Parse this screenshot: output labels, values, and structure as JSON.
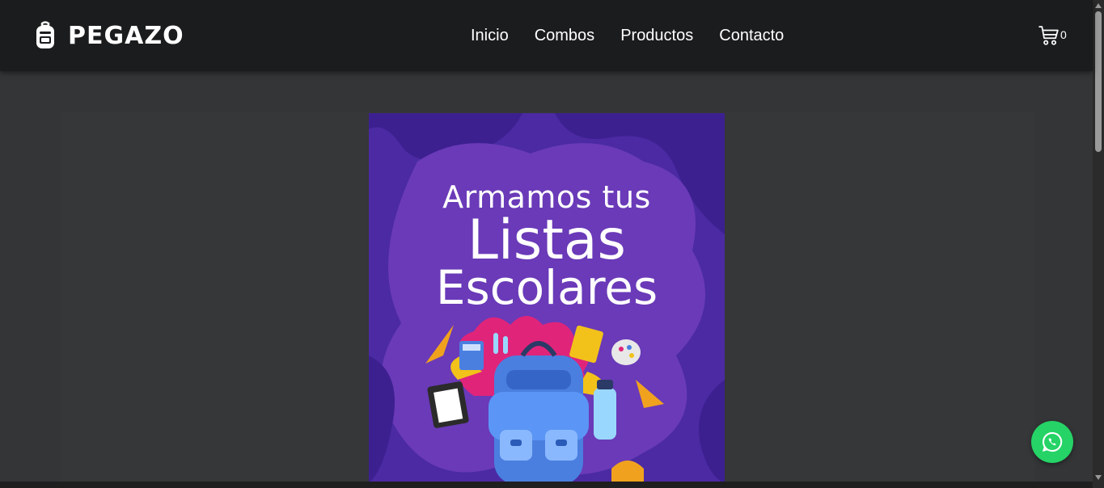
{
  "brand": {
    "name": "PEGAZO",
    "logo_icon": "backpack-icon"
  },
  "nav": {
    "links": [
      {
        "label": "Inicio"
      },
      {
        "label": "Combos"
      },
      {
        "label": "Productos"
      },
      {
        "label": "Contacto"
      }
    ]
  },
  "cart": {
    "icon": "cart-icon",
    "count": "0"
  },
  "banner": {
    "line1": "Armamos tus",
    "line2": "Listas",
    "line3": "Escolares",
    "background_color": "#4b2aa3",
    "accent_color": "#6a3ab8"
  },
  "whatsapp": {
    "icon": "whatsapp-icon",
    "color": "#25d366"
  },
  "colors": {
    "navbar": "#1b1c1e",
    "page": "#343537"
  }
}
